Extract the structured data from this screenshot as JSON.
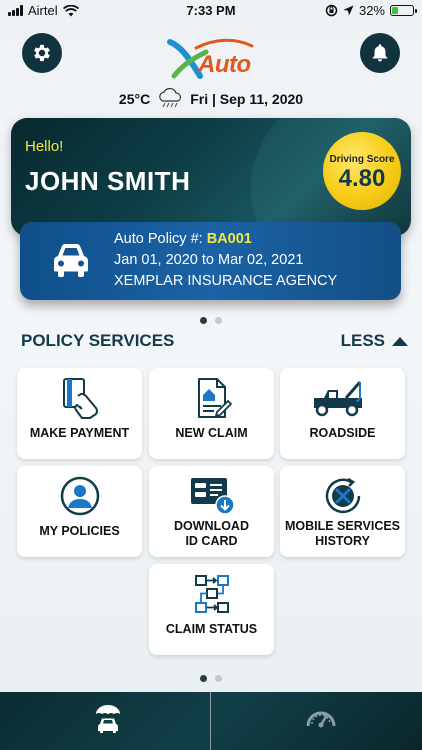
{
  "status_bar": {
    "carrier": "Airtel",
    "time": "7:33 PM",
    "battery": "32%",
    "battery_level": 0.32
  },
  "header": {
    "logo_text": "Auto",
    "temperature": "25°C",
    "date": "Fri | Sep 11, 2020",
    "weather_icon": "rain-cloud-icon"
  },
  "hero": {
    "greeting": "Hello!",
    "user_name": "JOHN SMITH",
    "score_label": "Driving Score",
    "score_value": "4.80"
  },
  "policy": {
    "label": "Auto Policy #: ",
    "number": "BA001",
    "period": "Jan 01, 2020 to Mar 02, 2021",
    "agency": "XEMPLAR INSURANCE AGENCY"
  },
  "services": {
    "title": "POLICY SERVICES",
    "toggle_label": "LESS",
    "tiles": [
      {
        "label": "MAKE PAYMENT",
        "icon": "payment-card-icon"
      },
      {
        "label": "NEW CLAIM",
        "icon": "claim-document-icon"
      },
      {
        "label": "ROADSIDE",
        "icon": "tow-truck-icon"
      },
      {
        "label": "MY POLICIES",
        "icon": "user-circle-icon"
      },
      {
        "label_line1": "DOWNLOAD",
        "label_line2": "ID CARD",
        "icon": "id-card-download-icon"
      },
      {
        "label_line1": "MOBILE SERVICES",
        "label_line2": "HISTORY",
        "icon": "service-history-icon"
      },
      {
        "label": "CLAIM STATUS",
        "icon": "claim-status-flow-icon"
      }
    ]
  },
  "bottom_nav": {
    "items": [
      {
        "icon": "umbrella-car-icon",
        "active": true
      },
      {
        "icon": "speedometer-icon",
        "active": false
      }
    ]
  },
  "colors": {
    "accent_yellow": "#f6e53d",
    "dark_teal": "#11333d",
    "policy_blue": "#1b63a6",
    "logo_orange": "#e2571b"
  }
}
